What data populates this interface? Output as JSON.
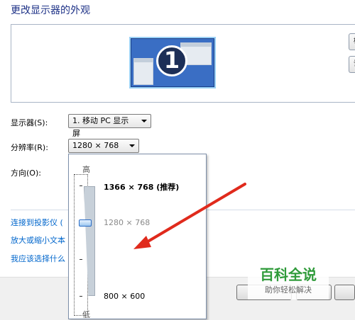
{
  "page": {
    "title": "更改显示器的外观"
  },
  "preview": {
    "monitor_number": "1",
    "side_buttons": [
      "检",
      "识"
    ]
  },
  "display": {
    "label": "显示器(S):",
    "value": "1. 移动 PC 显示屏"
  },
  "resolution": {
    "label": "分辨率(R):",
    "value": "1280 × 768",
    "dropdown": {
      "high_label": "高",
      "low_label": "低",
      "options": [
        "1366 × 768 (推荐)",
        "1280 × 768",
        "800 × 600"
      ],
      "selected_index": 1
    }
  },
  "orientation": {
    "label": "方向(O):"
  },
  "links": [
    "连接到投影仪 (",
    "放大或缩小文本",
    "我应该选择什么"
  ],
  "watermark": {
    "main": "百科全说",
    "sub": "助你轻松解决"
  },
  "colors": {
    "title": "#1e3287",
    "link": "#0066cc",
    "arrow": "#e02a1c",
    "watermark": "#2f9b3a"
  }
}
